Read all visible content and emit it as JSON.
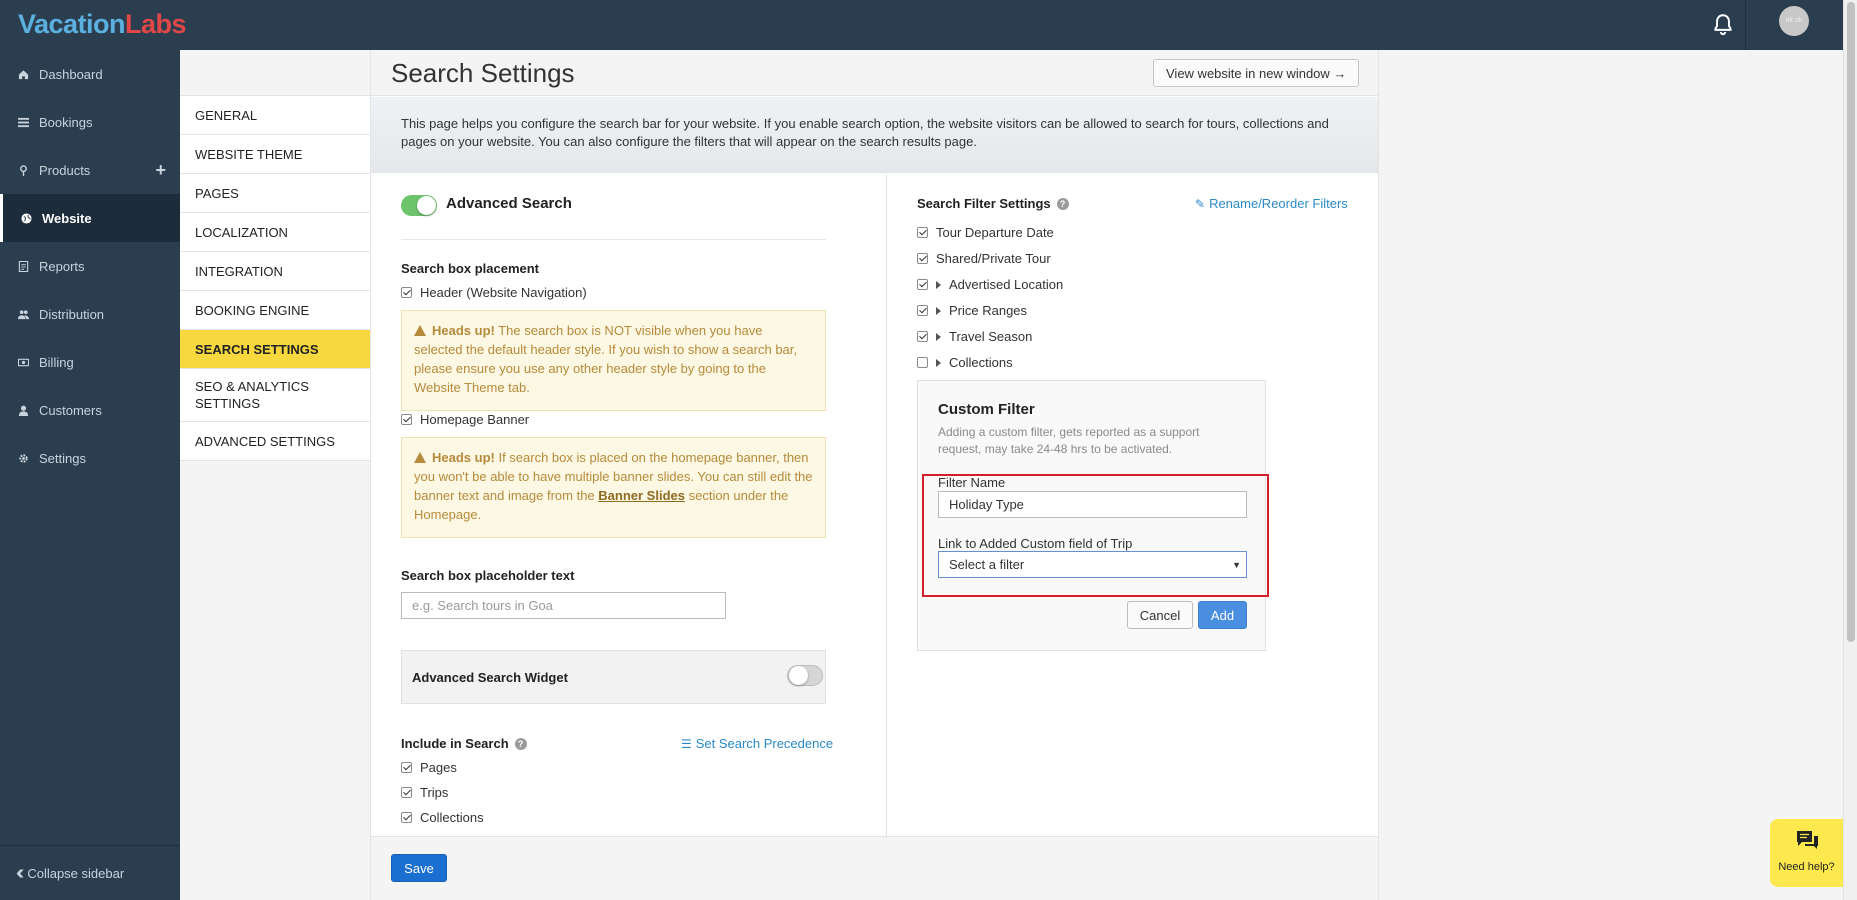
{
  "brand": {
    "part1": "Vacation",
    "part2": "Labs"
  },
  "topbar": {
    "avatar_text": "ok ok"
  },
  "sidebar": {
    "items": [
      {
        "label": "Dashboard",
        "icon": "home-icon"
      },
      {
        "label": "Bookings",
        "icon": "list-icon"
      },
      {
        "label": "Products",
        "icon": "pin-icon"
      },
      {
        "label": "Website",
        "icon": "globe-icon"
      },
      {
        "label": "Reports",
        "icon": "report-icon"
      },
      {
        "label": "Distribution",
        "icon": "users-icon"
      },
      {
        "label": "Billing",
        "icon": "money-icon"
      },
      {
        "label": "Customers",
        "icon": "user-icon"
      },
      {
        "label": "Settings",
        "icon": "gear-icon"
      }
    ],
    "active": "Website",
    "collapse_label": "Collapse sidebar"
  },
  "subnav": {
    "items": [
      "GENERAL",
      "WEBSITE THEME",
      "PAGES",
      "LOCALIZATION",
      "INTEGRATION",
      "BOOKING ENGINE",
      "SEARCH SETTINGS",
      "SEO & ANALYTICS SETTINGS",
      "ADVANCED SETTINGS"
    ],
    "active": "SEARCH SETTINGS"
  },
  "page": {
    "title": "Search Settings",
    "view_button": "View website in new window →",
    "intro": "This page helps you configure the search bar for your website. If you enable search option, the website visitors can be allowed to search for tours, collections and pages on your website. You can also configure the filters that will appear on the search results page."
  },
  "left": {
    "advanced_search_label": "Advanced Search",
    "advanced_search_on": true,
    "placement_heading": "Search box placement",
    "header_option": "Header (Website Navigation)",
    "header_checked": true,
    "alert1_strong": "Heads up!",
    "alert1_text": " The search box is NOT visible when you have selected the default header style. If you wish to show a search bar, please ensure you use any other header style by going to the Website Theme tab.",
    "homepage_option": "Homepage Banner",
    "homepage_checked": true,
    "alert2_strong": "Heads up!",
    "alert2_text_a": " If search box is placed on the homepage banner, then you won't be able to have multiple banner slides. You can still edit the banner text and image from the ",
    "alert2_link": "Banner Slides",
    "alert2_text_b": " section under the Homepage.",
    "placeholder_heading": "Search box placeholder text",
    "placeholder_input": {
      "value": "",
      "placeholder": "e.g. Search tours in Goa"
    },
    "widget_label": "Advanced Search Widget",
    "widget_on": false,
    "include_heading": "Include in Search",
    "precedence_link": "Set Search Precedence",
    "include_items": [
      {
        "label": "Pages",
        "checked": true
      },
      {
        "label": "Trips",
        "checked": true
      },
      {
        "label": "Collections",
        "checked": true
      }
    ]
  },
  "right": {
    "filter_heading": "Search Filter Settings",
    "rename_link": "Rename/Reorder Filters",
    "filters": [
      {
        "label": "Tour Departure Date",
        "checked": true,
        "expandable": false
      },
      {
        "label": "Shared/Private Tour",
        "checked": true,
        "expandable": false
      },
      {
        "label": "Advertised Location",
        "checked": true,
        "expandable": true
      },
      {
        "label": "Price Ranges",
        "checked": true,
        "expandable": true
      },
      {
        "label": "Travel Season",
        "checked": true,
        "expandable": true
      },
      {
        "label": "Collections",
        "checked": false,
        "expandable": true
      }
    ],
    "custom_filter": {
      "title": "Custom Filter",
      "desc": "Adding a custom filter, gets reported as a support request, may take 24-48 hrs to be activated.",
      "name_label": "Filter Name",
      "name_value": "Holiday Type",
      "link_label": "Link to Added Custom field of Trip",
      "select_value": "Select a filter",
      "cancel": "Cancel",
      "add": "Add"
    }
  },
  "footer": {
    "save": "Save"
  },
  "help_widget": {
    "label": "Need help?"
  },
  "colors": {
    "topbar": "#2b3e50",
    "active_subnav": "#f7d83e",
    "primary": "#1a6fd0",
    "toggle_on": "#6cc36c",
    "highlight_border": "#d2202a"
  }
}
